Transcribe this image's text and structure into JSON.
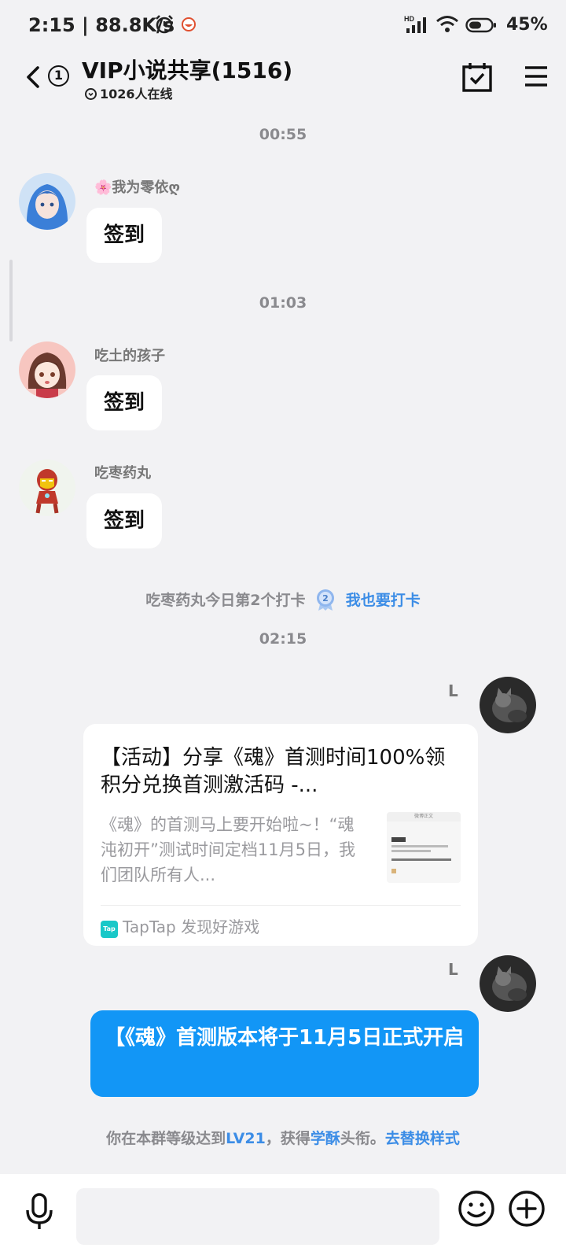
{
  "status_bar": {
    "time": "2:15",
    "net_speed": "88.8K/s",
    "signal_label": "HD",
    "battery": "45%"
  },
  "header": {
    "unread_count": "1",
    "title": "VIP小说共享(1516)",
    "online": "1026人在线"
  },
  "messages": [
    {
      "timestamp": "00:55",
      "sender": "🌸我为零依ღ",
      "text": "签到"
    },
    {
      "timestamp": "01:03",
      "sender": "吃土的孩子",
      "text": "签到"
    },
    {
      "sender": "吃枣药丸",
      "text": "签到"
    }
  ],
  "checkin_notice": {
    "text": "吃枣药丸今日第2个打卡",
    "medal_number": "2",
    "action": "我也要打卡"
  },
  "timestamp_3": "02:15",
  "my_name": "L",
  "share_card": {
    "title": "【活动】分享《魂》首测时间100%领积分兑换首测激活码 -...",
    "desc": "《魂》的首测马上要开始啦~！“魂沌初开”测试时间定档11月5日，我们团队所有人...",
    "thumb_header": "微博正文",
    "source_logo": "Tap",
    "source": "TapTap 发现好游戏"
  },
  "blue_message": "【《魂》首测版本将于11月5日正式开启",
  "level_note": {
    "prefix": "你在本群等级达到",
    "level": "LV21",
    "mid": "，获得",
    "title": "学酥",
    "suffix": "头衔。",
    "action": "去替换样式"
  },
  "colors": {
    "accent": "#1296f6",
    "link": "#3c8de6",
    "background": "#f2f2f4"
  }
}
